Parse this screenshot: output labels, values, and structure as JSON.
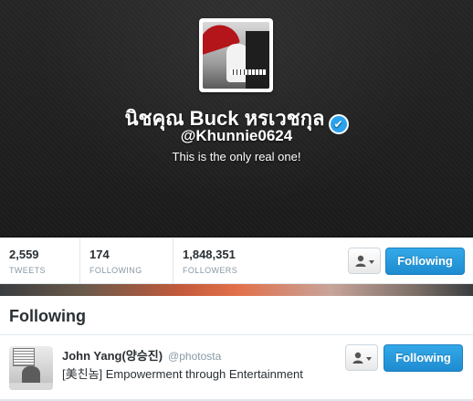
{
  "profile": {
    "name": "นิชคุณ Buck หรเวชกุล",
    "verified_glyph": "✔",
    "handle": "@Khunnie0624",
    "bio": "This is the only real one!"
  },
  "stats": {
    "tweets": {
      "value": "2,559",
      "label": "TWEETS"
    },
    "following": {
      "value": "174",
      "label": "FOLLOWING"
    },
    "followers": {
      "value": "1,848,351",
      "label": "FOLLOWERS"
    }
  },
  "actions": {
    "following_label": "Following",
    "user_menu_icon": "user-dropdown-icon"
  },
  "following_section": {
    "title": "Following",
    "items": [
      {
        "name": "John Yang(양승진)",
        "handle": "@photosta",
        "bio": "[美친놈] Empowerment through Entertainment",
        "button_label": "Following"
      }
    ]
  },
  "colors": {
    "accent": "#2aa3ef",
    "following_button": "#2b9fe0",
    "header_bg": "#222222"
  }
}
